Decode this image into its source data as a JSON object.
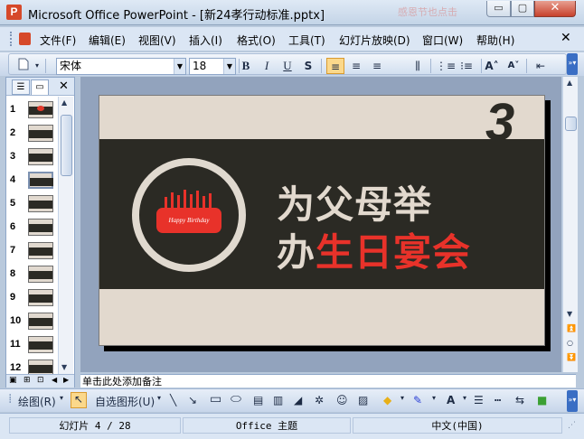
{
  "window": {
    "title": "Microsoft Office PowerPoint - [新24孝行动标准.pptx]",
    "app_icon": "P",
    "background_deco": "感恩节也点击",
    "controls": {
      "minimize": "▭",
      "maximize": "▢",
      "close": "✕"
    }
  },
  "menu": {
    "items": [
      "文件(F)",
      "编辑(E)",
      "视图(V)",
      "插入(I)",
      "格式(O)",
      "工具(T)",
      "幻灯片放映(D)",
      "窗口(W)",
      "帮助(H)"
    ],
    "close_doc": "✕"
  },
  "toolbar": {
    "font_name": "宋体",
    "font_size": "18",
    "bold": "B",
    "italic": "I",
    "underline": "U",
    "shadow": "S",
    "align_left": "≡",
    "align_center": "≡",
    "align_right": "≡",
    "distributed": "⫼",
    "numbering": "⋮≡",
    "bullets": "⁝≡",
    "font_grow": "A˄",
    "font_shrink": "A˅",
    "decrease_indent": "⇤"
  },
  "slides_panel": {
    "tab_outline": "☰",
    "tab_slides": "▭",
    "close": "✕",
    "slide_numbers": [
      "1",
      "2",
      "3",
      "4",
      "5",
      "6",
      "7",
      "8",
      "9",
      "10",
      "11",
      "12"
    ],
    "selected_slide": "4",
    "view_normal": "▣",
    "view_sorter": "⊞",
    "view_show": "⊡"
  },
  "slide": {
    "number": "3",
    "title_line1": "为父母举",
    "title_line2_pre": "办",
    "title_line2_highlight": "生日宴会",
    "cake_text": "Happy Birthday",
    "accent_color": "#e8322a",
    "band_color": "#2b2a24",
    "bg_color": "#e2d9ce"
  },
  "notes": {
    "placeholder": "单击此处添加备注"
  },
  "drawing_toolbar": {
    "draw_menu": "绘图(R)",
    "autoshapes_menu": "自选图形(U)"
  },
  "status": {
    "slide_position": "幻灯片 4 / 28",
    "theme": "Office 主题",
    "language": "中文(中国)"
  }
}
